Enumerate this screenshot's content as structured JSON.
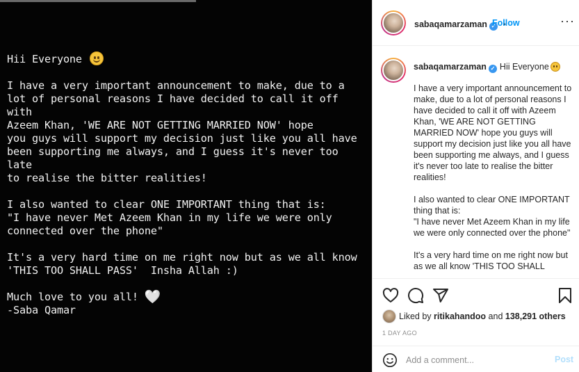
{
  "story": {
    "line1": "Hii Everyone ",
    "para1": "I have a very important announcement to make, due to a\nlot of personal reasons I have decided to call it off with\nAzeem Khan, 'WE ARE NOT GETTING MARRIED NOW' hope\nyou guys will support my decision just like you all have\nbeen supporting me always, and I guess it's never too late\nto realise the bitter realities!",
    "para2": "I also wanted to clear ONE IMPORTANT thing that is:\n\"I have never Met Azeem Khan in my life we were only\nconnected over the phone\"",
    "para3": "It's a very hard time on me right now but as we all know\n'THIS TOO SHALL PASS'  Insha Allah :)",
    "para4": "Much love to you all! ",
    "heart": "🤍",
    "signoff": "-Saba Qamar"
  },
  "header": {
    "username": "sabaqamarzaman",
    "verified": "✓",
    "follow_label": "Follow",
    "separator": "•",
    "more": "···"
  },
  "caption": {
    "username": "sabaqamarzaman",
    "first_line": "Hii Everyone",
    "para1": "I have a very important announcement to make, due to a lot of personal reasons I have decided to call it off with Azeem Khan, 'WE ARE NOT GETTING MARRIED NOW' hope you guys will support my decision just like you all have been supporting me always, and I guess it's never too late to realise the bitter realities!",
    "para2_a": "I also wanted to clear ONE IMPORTANT thing that is:",
    "para2_b": "\"I have never Met Azeem Khan in my life we were only connected over the phone\"",
    "para3": "It's a very hard time on me right now but as we all know 'THIS TOO SHALL"
  },
  "likes": {
    "prefix": "Liked by ",
    "user": "ritikahandoo",
    "and": " and ",
    "count": "138,291 others"
  },
  "timestamp": "1 DAY AGO",
  "comment": {
    "placeholder": "Add a comment...",
    "post_label": "Post"
  },
  "colors": {
    "accent": "#0095f6",
    "post_disabled": "#b2dffc",
    "verified": "#3897f0"
  },
  "icons": [
    "heart-icon",
    "comment-icon",
    "share-icon",
    "save-icon",
    "emoji-icon",
    "more-icon",
    "verified-icon"
  ]
}
